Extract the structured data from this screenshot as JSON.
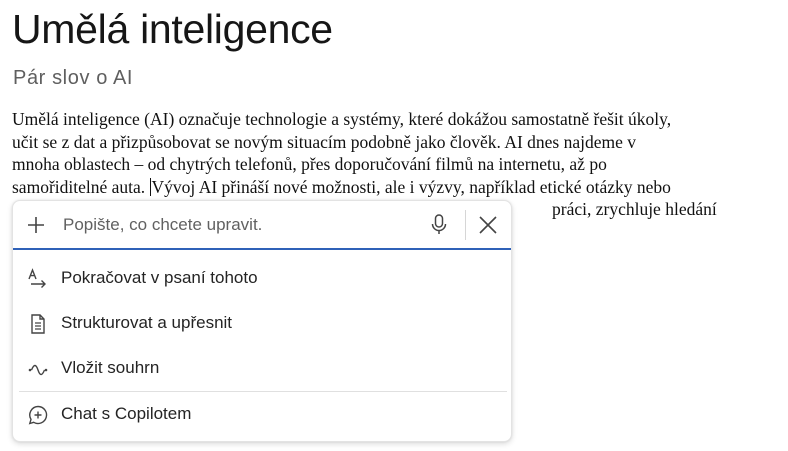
{
  "document": {
    "title": "Umělá inteligence",
    "subtitle": "Pár slov o AI",
    "body_lines": [
      "Umělá inteligence (AI) označuje technologie a systémy, které dokážou samostatně řešit úkoly,",
      "učit se z dat a přizpůsobovat se novým situacím podobně jako člověk. AI dnes najdeme v",
      "mnoha oblastech – od chytrých telefonů, přes doporučování filmů na internetu, až po",
      "samořiditelné auta. ",
      "Vývoj AI přináší nové možnosti, ale i výzvy, například etické otázky nebo",
      "práci, zrychluje hledání"
    ]
  },
  "copilot": {
    "prompt_placeholder": "Popište, co chcete upravit.",
    "prompt_value": "",
    "accent_color": "#2f61b8",
    "menu": [
      {
        "label": "Pokračovat v psaní tohoto",
        "icon": "continue-writing-icon"
      },
      {
        "label": "Strukturovat a upřesnit",
        "icon": "document-icon"
      },
      {
        "label": "Vložit souhrn",
        "icon": "summary-wave-icon"
      },
      {
        "label": "Chat s Copilotem",
        "icon": "chat-add-icon"
      }
    ]
  }
}
